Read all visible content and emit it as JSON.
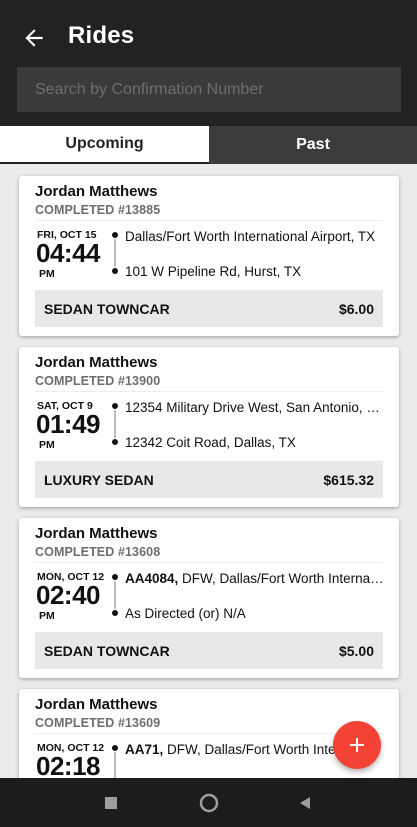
{
  "header": {
    "title": "Rides",
    "back_icon": "arrow-left-icon"
  },
  "search": {
    "placeholder": "Search by Confirmation Number",
    "value": ""
  },
  "tabs": [
    {
      "label": "Upcoming",
      "active": true
    },
    {
      "label": "Past",
      "active": false
    }
  ],
  "rides": [
    {
      "passenger": "Jordan Matthews",
      "status": "COMPLETED #13885",
      "date": "FRI, OCT 15",
      "time": "04:44",
      "ampm": "PM",
      "pickup_bold": "",
      "pickup": "Dallas/Fort Worth International Airport, TX",
      "dropoff": "101 W Pipeline Rd, Hurst, TX",
      "vehicle": "SEDAN TOWNCAR",
      "price": "$6.00"
    },
    {
      "passenger": "Jordan Matthews",
      "status": "COMPLETED #13900",
      "date": "SAT, OCT 9",
      "time": "01:49",
      "ampm": "PM",
      "pickup_bold": "",
      "pickup": "12354 Military Drive West, San Antonio, …",
      "dropoff": "12342 Coit Road, Dallas, TX",
      "vehicle": "LUXURY SEDAN",
      "price": "$615.32"
    },
    {
      "passenger": "Jordan Matthews",
      "status": "COMPLETED #13608",
      "date": "MON, OCT 12",
      "time": "02:40",
      "ampm": "PM",
      "pickup_bold": "AA4084,",
      "pickup": " DFW, Dallas/Fort Worth Interna…",
      "dropoff": "As Directed (or) N/A",
      "vehicle": "SEDAN TOWNCAR",
      "price": "$5.00"
    },
    {
      "passenger": "Jordan Matthews",
      "status": "COMPLETED #13609",
      "date": "MON, OCT 12",
      "time": "02:18",
      "ampm": "PM",
      "pickup_bold": "AA71,",
      "pickup": " DFW, Dallas/Fort Worth Inte…",
      "dropoff": "",
      "vehicle": "",
      "price": ""
    }
  ],
  "fab": {
    "icon": "plus-icon"
  },
  "navbar": {
    "icons": [
      "square-icon",
      "circle-icon",
      "triangle-back-icon"
    ]
  },
  "colors": {
    "header_bg": "#222222",
    "search_bg": "#3a3a3a",
    "fab": "#f44336",
    "past_tab_bg": "#3b3b3b"
  }
}
